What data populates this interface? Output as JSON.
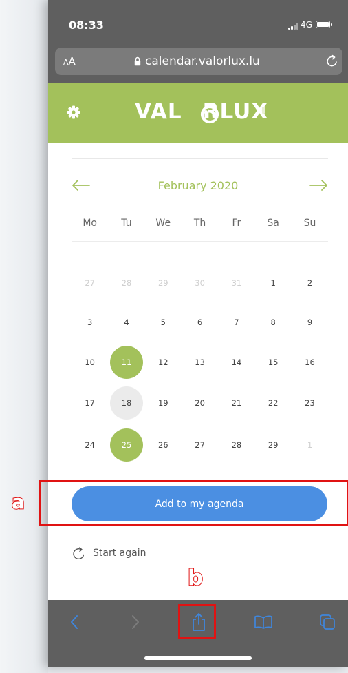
{
  "status_bar": {
    "time": "08:33",
    "network": "4G"
  },
  "browser": {
    "text_size_small": "A",
    "text_size_large": "A",
    "url": "calendar.valorlux.lu"
  },
  "header": {
    "logo_left": "VAL",
    "logo_right": "RLUX"
  },
  "calendar": {
    "month_label": "February 2020",
    "weekdays": [
      "Mo",
      "Tu",
      "We",
      "Th",
      "Fr",
      "Sa",
      "Su"
    ],
    "weeks": [
      [
        {
          "d": "27",
          "muted": true
        },
        {
          "d": "28",
          "muted": true
        },
        {
          "d": "29",
          "muted": true
        },
        {
          "d": "30",
          "muted": true
        },
        {
          "d": "31",
          "muted": true
        },
        {
          "d": "1"
        },
        {
          "d": "2"
        }
      ],
      [
        {
          "d": "3"
        },
        {
          "d": "4"
        },
        {
          "d": "5"
        },
        {
          "d": "6"
        },
        {
          "d": "7"
        },
        {
          "d": "8"
        },
        {
          "d": "9"
        }
      ],
      [
        {
          "d": "10"
        },
        {
          "d": "11",
          "state": "selected"
        },
        {
          "d": "12"
        },
        {
          "d": "13"
        },
        {
          "d": "14"
        },
        {
          "d": "15"
        },
        {
          "d": "16"
        }
      ],
      [
        {
          "d": "17"
        },
        {
          "d": "18",
          "state": "today"
        },
        {
          "d": "19"
        },
        {
          "d": "20"
        },
        {
          "d": "21"
        },
        {
          "d": "22"
        },
        {
          "d": "23"
        }
      ],
      [
        {
          "d": "24"
        },
        {
          "d": "25",
          "state": "selected"
        },
        {
          "d": "26"
        },
        {
          "d": "27"
        },
        {
          "d": "28"
        },
        {
          "d": "29"
        },
        {
          "d": "1",
          "muted": true
        }
      ]
    ]
  },
  "actions": {
    "add_to_agenda": "Add to my agenda",
    "start_again": "Start again"
  },
  "annotations": {
    "a": "a",
    "b": "b"
  },
  "colors": {
    "brand_green": "#a3c15b",
    "button_blue": "#4b8fe2",
    "chrome_gray": "#5f5f5f",
    "annotation_red": "#e01313",
    "icon_blue": "#3f86dc"
  },
  "icons": [
    "settings-gear-icon",
    "back-arrow-icon",
    "forward-arrow-icon",
    "refresh-icon",
    "lock-icon",
    "share-icon",
    "bookmarks-icon",
    "tabs-icon",
    "chevron-left-icon",
    "chevron-right-icon"
  ]
}
